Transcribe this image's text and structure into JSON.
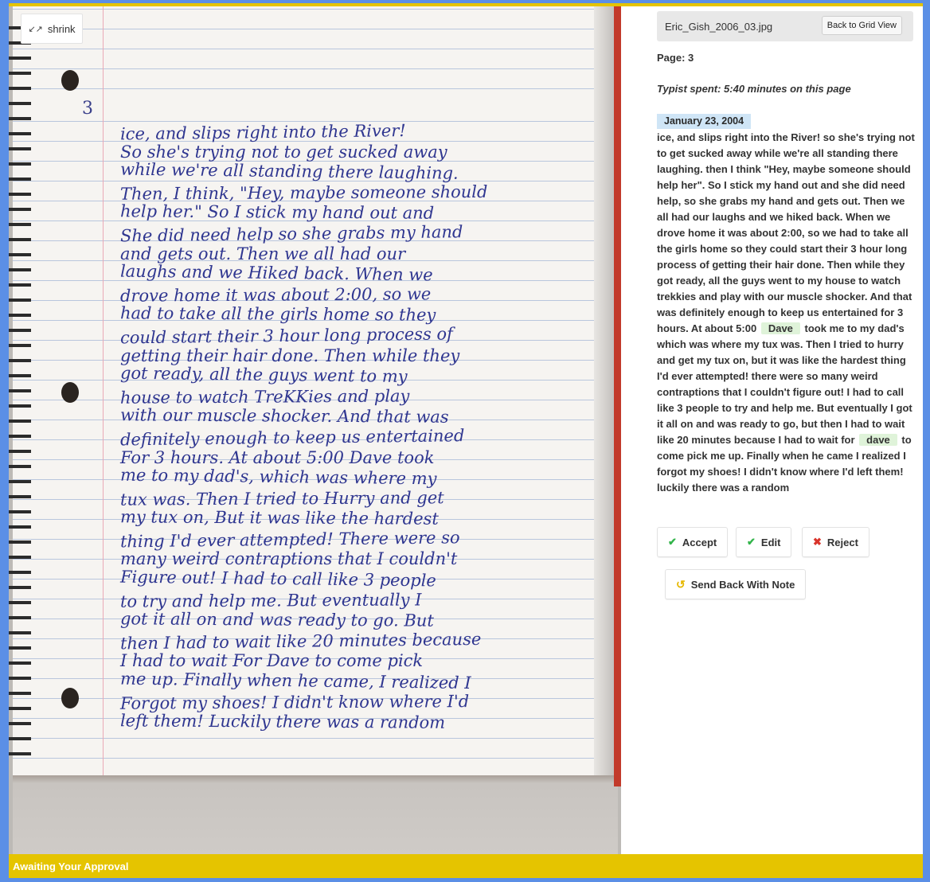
{
  "viewer": {
    "shrink_label": "shrink",
    "shrink_icon": "shrink-arrows-icon",
    "page_number_mark": "3",
    "handwritten_lines": [
      "ice, and slips right into the River!",
      "So she's trying not to get sucked away",
      "while we're all standing there laughing.",
      "Then, I think, \"Hey, maybe someone should",
      "help her.\" So I stick my hand out and",
      "She did need help so she grabs my hand",
      "and gets out. Then we all had our",
      "laughs and we Hiked back. When we",
      "drove home it was about 2:00, so we",
      "had to take all the girls home so they",
      "could start their 3 hour long process of",
      "getting their hair done. Then while they",
      "got ready, all the guys went to my",
      "house to watch TreKKies and play",
      "with our muscle shocker. And that was",
      "definitely enough to keep us entertained",
      "For 3 hours. At about 5:00 Dave took",
      "me to my dad's, which was where my",
      "tux was. Then I tried to Hurry and get",
      "my tux on, But it was like the hardest",
      "thing I'd ever attempted! There were so",
      "many weird contraptions that I couldn't",
      "Figure out! I had to call like 3 people",
      "to try and help me. But eventually I",
      "got it all on and was ready to go. But",
      "then I had to wait like 20 minutes because",
      "I had to wait For Dave to come pick",
      "me up. Finally when he came, I realized I",
      "Forgot my shoes! I didn't know where I'd",
      "left them! Luckily there was a random"
    ]
  },
  "header": {
    "file_name": "Eric_Gish_2006_03.jpg",
    "back_button": "Back to Grid View"
  },
  "meta": {
    "page_label": "Page: 3",
    "typist_label": "Typist spent: 5:40 minutes on this page"
  },
  "transcript": {
    "date": "January 23, 2004",
    "part1": "ice, and slips right into the River! so she's trying not to get sucked away while we're all standing there laughing. then I think \"Hey, maybe someone should help her\". So I stick my hand out and she did need help, so she grabs my hand and gets out. Then we all had our laughs and we hiked back. When we drove home it was about 2:00, so we had to take all the girls home so they could start their 3 hour long process of getting their hair done. Then while they got ready, all the guys went to my house to watch trekkies and play with our muscle shocker. And that was definitely enough to keep us entertained for 3 hours. At about 5:00",
    "name1": "Dave",
    "part2": "took me to my dad's which was where my tux was. Then I tried to hurry and get my tux on, but it was like the hardest thing I'd ever attempted! there were so many weird contraptions that I couldn't figure out! I had to call like 3 people to try and help me. But eventually I got it all on and was ready to go, but then I had to wait like 20 minutes because I had to wait for",
    "name2": "dave",
    "part3": "to come pick me up. Finally when he came I realized I forgot my shoes! I didn't know where I'd left them! luckily there was a random"
  },
  "actions": {
    "accept": "Accept",
    "edit": "Edit",
    "reject": "Reject",
    "send_back": "Send Back With Note",
    "accept_icon": "check-icon",
    "edit_icon": "check-icon",
    "reject_icon": "x-icon",
    "send_back_icon": "undo-icon"
  },
  "status": {
    "text": "Awaiting Your Approval"
  },
  "colors": {
    "frame_blue": "#5b8fe6",
    "status_yellow": "#e5c400",
    "date_blue": "#cfe5f6",
    "name_green": "#dff3d9",
    "accept_green": "#32b44a",
    "reject_red": "#d9342b",
    "ink_blue": "#2f3690"
  }
}
